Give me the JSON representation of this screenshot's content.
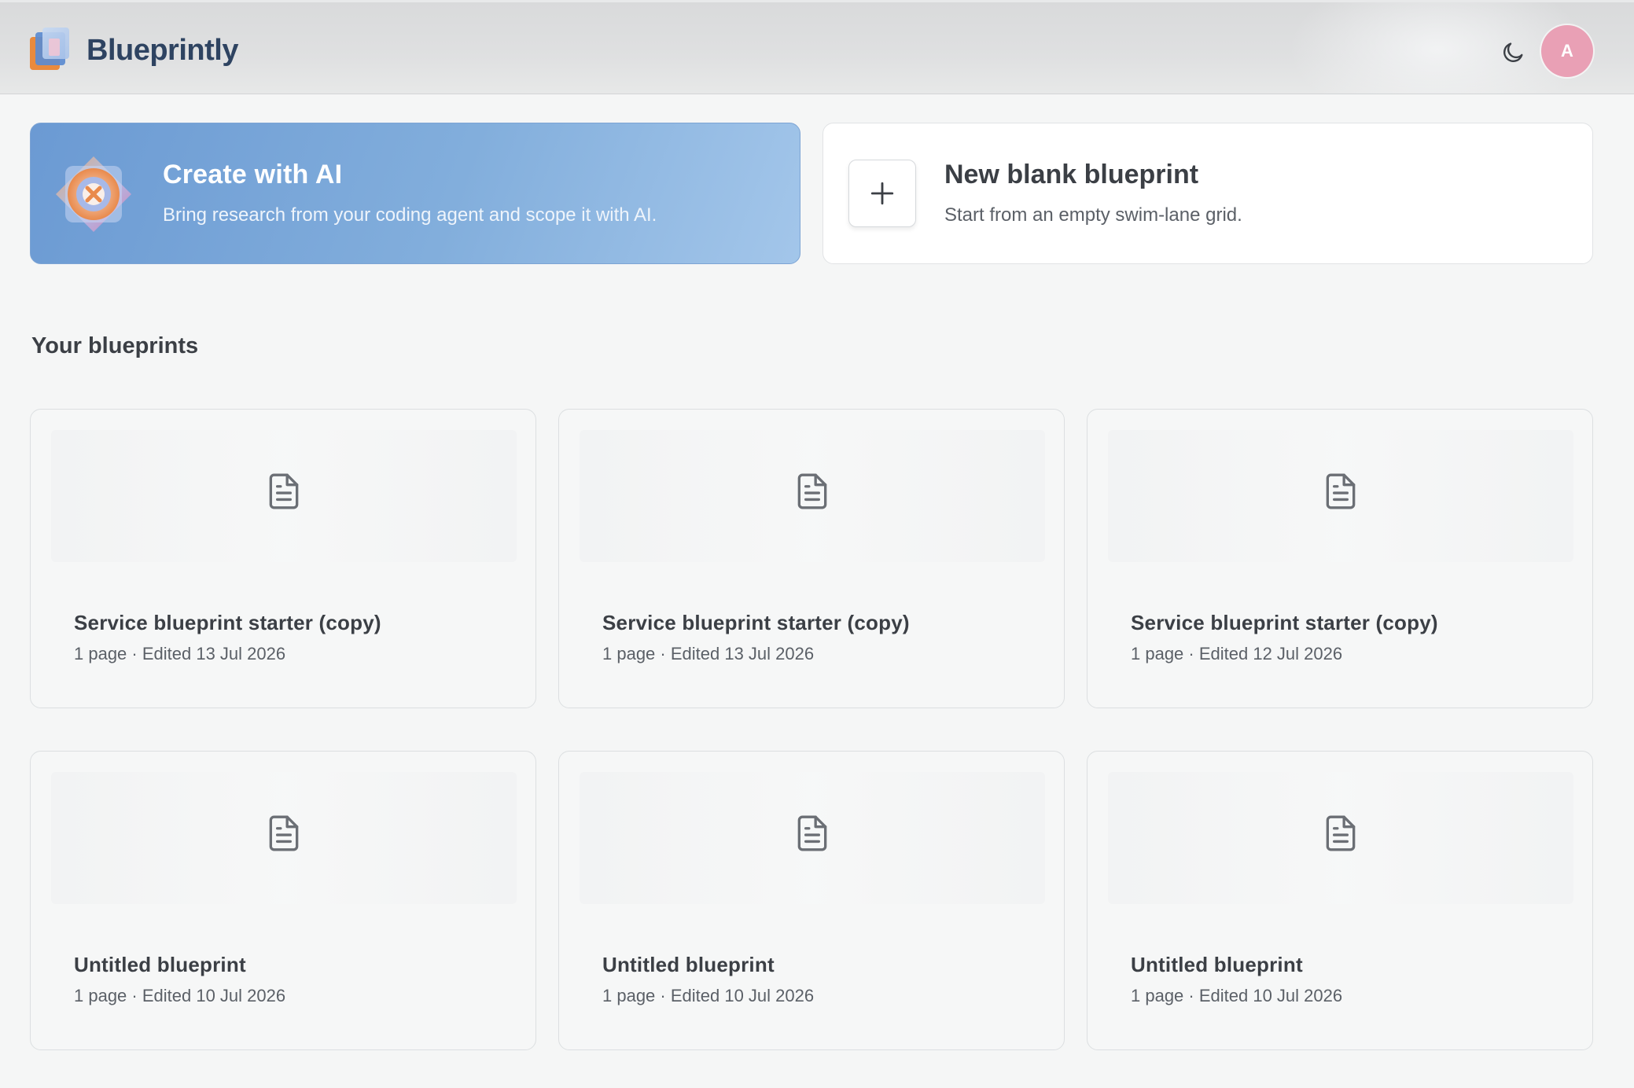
{
  "app": {
    "brand_name": "Blueprintly",
    "theme_icon": "moon-icon",
    "avatar_initial": "A",
    "avatar_color": "#e9a0b5"
  },
  "actions": {
    "ai": {
      "title": "Create with AI",
      "subtitle": "Bring research from your coding agent and scope it with AI.",
      "icon": "ai-sparkle-icon"
    },
    "blank": {
      "title": "New blank blueprint",
      "subtitle": "Start from an empty swim-lane grid.",
      "icon": "plus-icon"
    }
  },
  "section": {
    "title": "Your blueprints"
  },
  "blueprints": [
    {
      "title": "Service blueprint starter (copy)",
      "meta": "1 page · Edited 13 Jul 2026"
    },
    {
      "title": "Service blueprint starter (copy)",
      "meta": "1 page · Edited 13 Jul 2026"
    },
    {
      "title": "Service blueprint starter (copy)",
      "meta": "1 page · Edited 12 Jul 2026"
    },
    {
      "title": "Untitled blueprint",
      "meta": "1 page · Edited 10 Jul 2026"
    },
    {
      "title": "Untitled blueprint",
      "meta": "1 page · Edited 10 Jul 2026"
    },
    {
      "title": "Untitled blueprint",
      "meta": "1 page · Edited 10 Jul 2026"
    }
  ],
  "colors": {
    "brand_text": "#2e4361",
    "ai_gradient_start": "#6b9ad3",
    "ai_gradient_end": "#a3c6ea",
    "page_background": "#f5f6f6"
  }
}
